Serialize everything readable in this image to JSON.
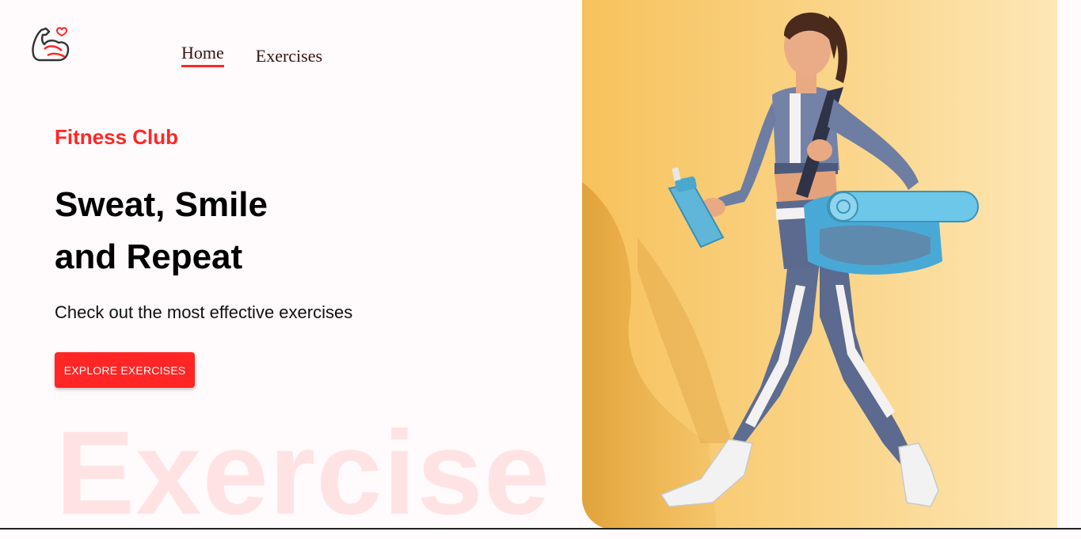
{
  "nav": {
    "home_label": "Home",
    "exercises_label": "Exercises"
  },
  "hero": {
    "subtitle": "Fitness Club",
    "headline_line1": "Sweat, Smile",
    "headline_line2": "and Repeat",
    "description": "Check out the most effective exercises",
    "cta_label": "EXPLORE EXERCISES",
    "background_word": "Exercise"
  },
  "icons": {
    "logo": "flexed-arm-heart-icon"
  },
  "colors": {
    "accent": "#ff2625",
    "text_dark": "#3a1212",
    "page_bg": "#fffafb",
    "banner_bg": "#f9c969"
  }
}
